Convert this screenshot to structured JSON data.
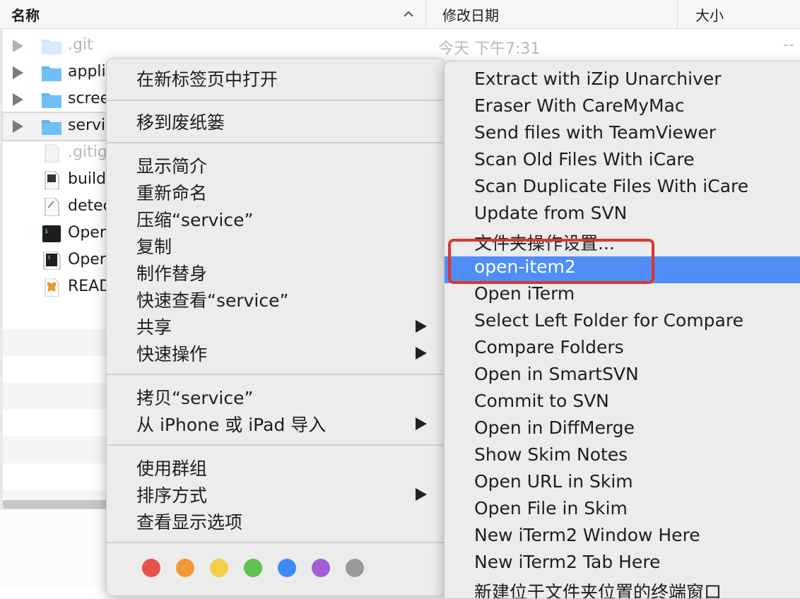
{
  "header": {
    "name": "名称",
    "date": "修改日期",
    "size": "大小"
  },
  "rows": [
    {
      "name": ".git",
      "type": "folder",
      "expandable": true,
      "dim": true,
      "date": "今天 下午7:31",
      "size": "--"
    },
    {
      "name": "appli",
      "type": "folder",
      "expandable": true
    },
    {
      "name": "scree",
      "type": "folder",
      "expandable": true
    },
    {
      "name": "servi",
      "type": "folder",
      "expandable": true,
      "selected": true
    },
    {
      "name": ".gitig",
      "type": "file",
      "dim": true
    },
    {
      "name": "build",
      "type": "python-file"
    },
    {
      "name": "detec",
      "type": "text-file"
    },
    {
      "name": "Oper",
      "type": "terminal"
    },
    {
      "name": "Oper",
      "type": "terminal-doc"
    },
    {
      "name": "READ",
      "type": "readme"
    }
  ],
  "context_menu": {
    "items": [
      "在新标签页中打开",
      "移到废纸篓",
      "显示简介",
      "重新命名",
      "压缩“service”",
      "复制",
      "制作替身",
      "快速查看“service”",
      "共享",
      "快速操作",
      "拷贝“service”",
      "从 iPhone 或 iPad 导入",
      "使用群组",
      "排序方式",
      "查看显示选项"
    ],
    "tag_colors": [
      "#e8524a",
      "#f09a37",
      "#f6cf48",
      "#5fc250",
      "#3d8bf5",
      "#a35ed6",
      "#9a9a9a"
    ]
  },
  "services_menu": {
    "items": [
      "Extract with iZip Unarchiver",
      "Eraser With CareMyMac",
      "Send files with TeamViewer",
      "Scan Old Files With iCare",
      "Scan Duplicate Files With iCare",
      "Update from SVN",
      "文件夹操作设置...",
      "open-item2",
      "Open iTerm",
      "Select Left Folder for Compare",
      "Compare Folders",
      "Open in SmartSVN",
      "Commit to SVN",
      "Open in DiffMerge",
      "Show Skim Notes",
      "Open URL in Skim",
      "Open File in Skim",
      "New iTerm2 Window Here",
      "New iTerm2 Tab Here",
      "新建位于文件夹位置的终端窗口"
    ],
    "highlighted": "open-item2",
    "highlight_color": "#4f8ef7",
    "annotation_color": "#e0342a"
  }
}
